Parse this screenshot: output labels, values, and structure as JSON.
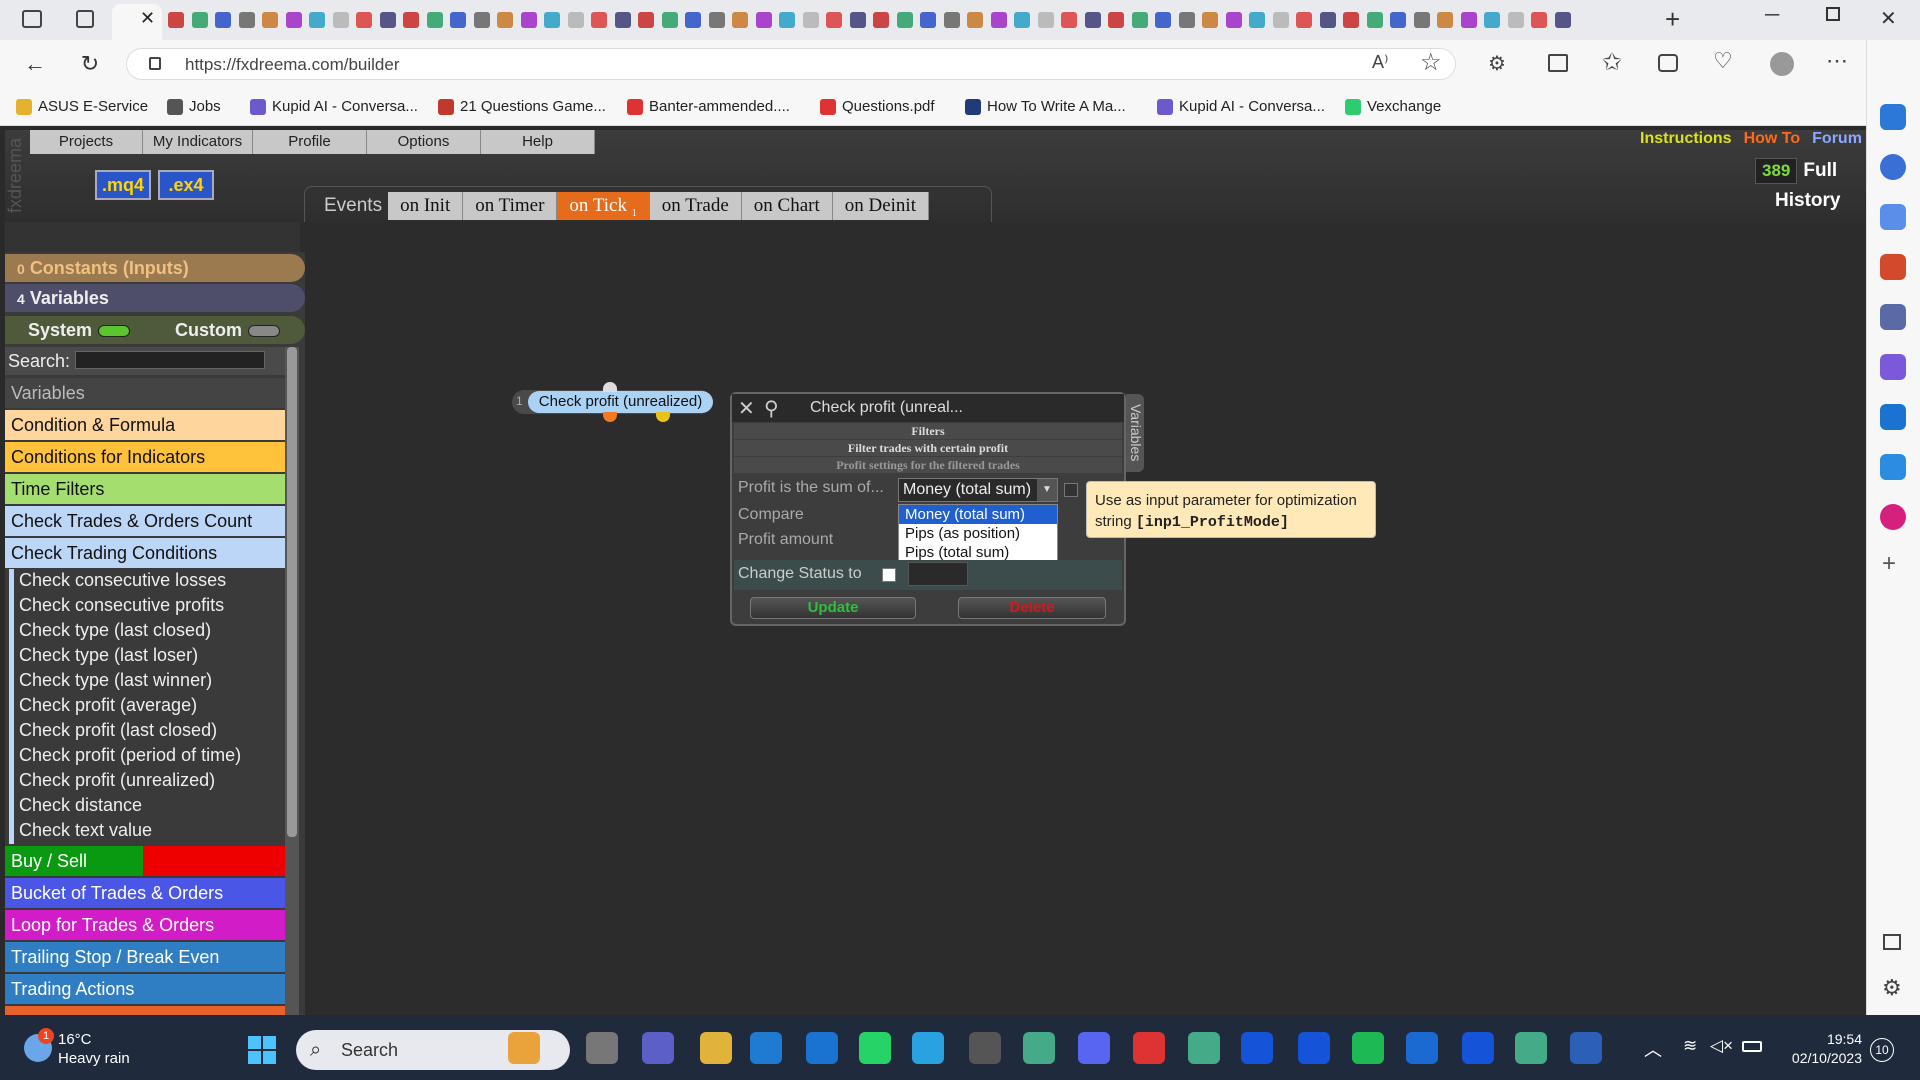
{
  "browser": {
    "url": "https://fxdreema.com/builder",
    "bookmarks": [
      "ASUS E-Service",
      "Jobs",
      "Kupid AI - Conversa...",
      "21 Questions Game...",
      "Banter-ammended....",
      "Questions.pdf",
      "How To Write A Ma...",
      "Kupid AI - Conversa...",
      "Vexchange"
    ]
  },
  "app": {
    "brand": "fxdreema",
    "menu": [
      "Projects",
      "My Indicators",
      "Profile",
      "Options",
      "Help"
    ],
    "export_buttons": [
      ".mq4",
      ".ex4"
    ],
    "events_label": "Events",
    "events": [
      "on Init",
      "on Timer",
      "on Tick",
      "on Trade",
      "on Chart",
      "on Deinit"
    ],
    "active_event": "on Tick",
    "active_event_badge": "1",
    "top_links": {
      "instructions": "Instructions",
      "howto": "How To",
      "forum": "Forum"
    },
    "counter": "389",
    "full_label": "Full",
    "history_label": "History"
  },
  "left_panel": {
    "constants": {
      "count": "0",
      "label": "Constants (Inputs)"
    },
    "variables": {
      "count": "4",
      "label": "Variables"
    },
    "system_label": "System",
    "custom_label": "Custom",
    "search_label": "Search:",
    "categories_top": [
      "Variables",
      "Condition & Formula",
      "Conditions for Indicators",
      "Time Filters",
      "Check Trades & Orders Count",
      "Check Trading Conditions"
    ],
    "sub_items": [
      "Check consecutive losses",
      "Check consecutive profits",
      "Check type (last closed)",
      "Check type (last loser)",
      "Check type (last winner)",
      "Check profit (average)",
      "Check profit (last closed)",
      "Check profit (period of time)",
      "Check profit (unrealized)",
      "Check distance",
      "Check text value"
    ],
    "categories_bottom": [
      "Buy / Sell",
      "Bucket of Trades & Orders",
      "Loop for Trades & Orders",
      "Trailing Stop / Break Even",
      "Trading Actions"
    ]
  },
  "block": {
    "number": "1",
    "label": "Check profit (unrealized)"
  },
  "dialog": {
    "title": "Check profit (unreal...",
    "side_tab": "Variables",
    "header_filters": "Filters",
    "header_filter_profit": "Filter trades with certain profit",
    "header_profit_settings": "Profit settings for the filtered trades",
    "row_sum_label": "Profit is the sum of...",
    "row_compare_label": "Compare",
    "row_amount_label": "Profit amount",
    "selected": "Money (total sum)",
    "options": [
      "Money (total sum)",
      "Pips (as position)",
      "Pips (total sum)"
    ],
    "change_status_label": "Change Status to",
    "update_btn": "Update",
    "delete_btn": "Delete",
    "tooltip_line1": "Use as input parameter for optimization",
    "tooltip_line2_prefix": "string ",
    "tooltip_code": "[inp1_ProfitMode]"
  },
  "taskbar": {
    "temp": "16°C",
    "weather": "Heavy rain",
    "weather_badge": "1",
    "search": "Search",
    "time": "19:54",
    "date": "02/10/2023",
    "notif": "10"
  }
}
